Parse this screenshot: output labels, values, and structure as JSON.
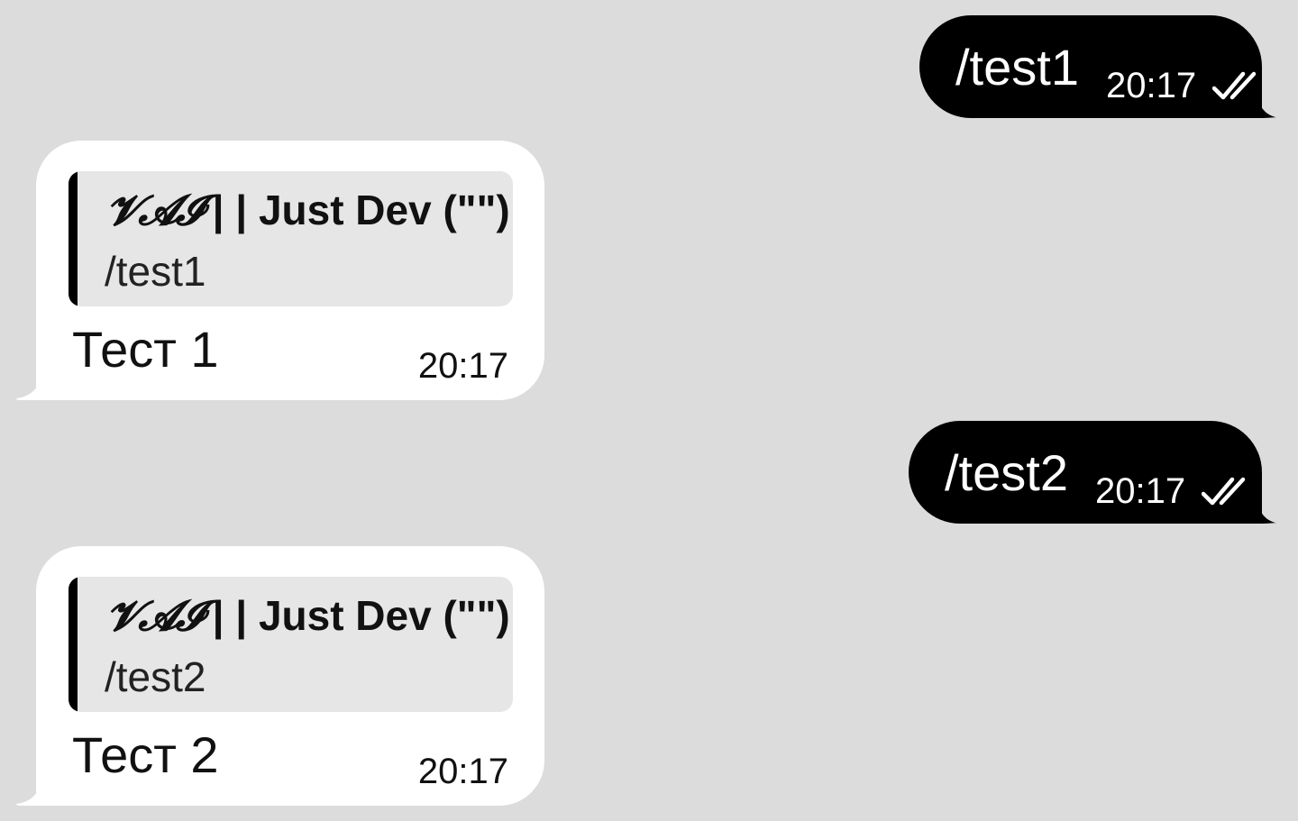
{
  "messages": [
    {
      "direction": "outgoing",
      "text": "/test1",
      "time": "20:17",
      "status_icon": "double-check-icon"
    },
    {
      "direction": "incoming",
      "reply_to": {
        "author_decor": "𝓥𝓐𝓘",
        "author_rest": " | | Just Dev (\"\");",
        "text": "/test1"
      },
      "text": "Тест 1",
      "time": "20:17"
    },
    {
      "direction": "outgoing",
      "text": "/test2",
      "time": "20:17",
      "status_icon": "double-check-icon"
    },
    {
      "direction": "incoming",
      "reply_to": {
        "author_decor": "𝓥𝓐𝓘",
        "author_rest": " | | Just Dev (\"\");",
        "text": "/test2"
      },
      "text": "Тест 2",
      "time": "20:17"
    }
  ],
  "colors": {
    "background": "#dcdcdc",
    "outgoing_bubble": "#000000",
    "incoming_bubble": "#ffffff",
    "quote_background": "#e6e6e6",
    "quote_bar": "#000000"
  }
}
